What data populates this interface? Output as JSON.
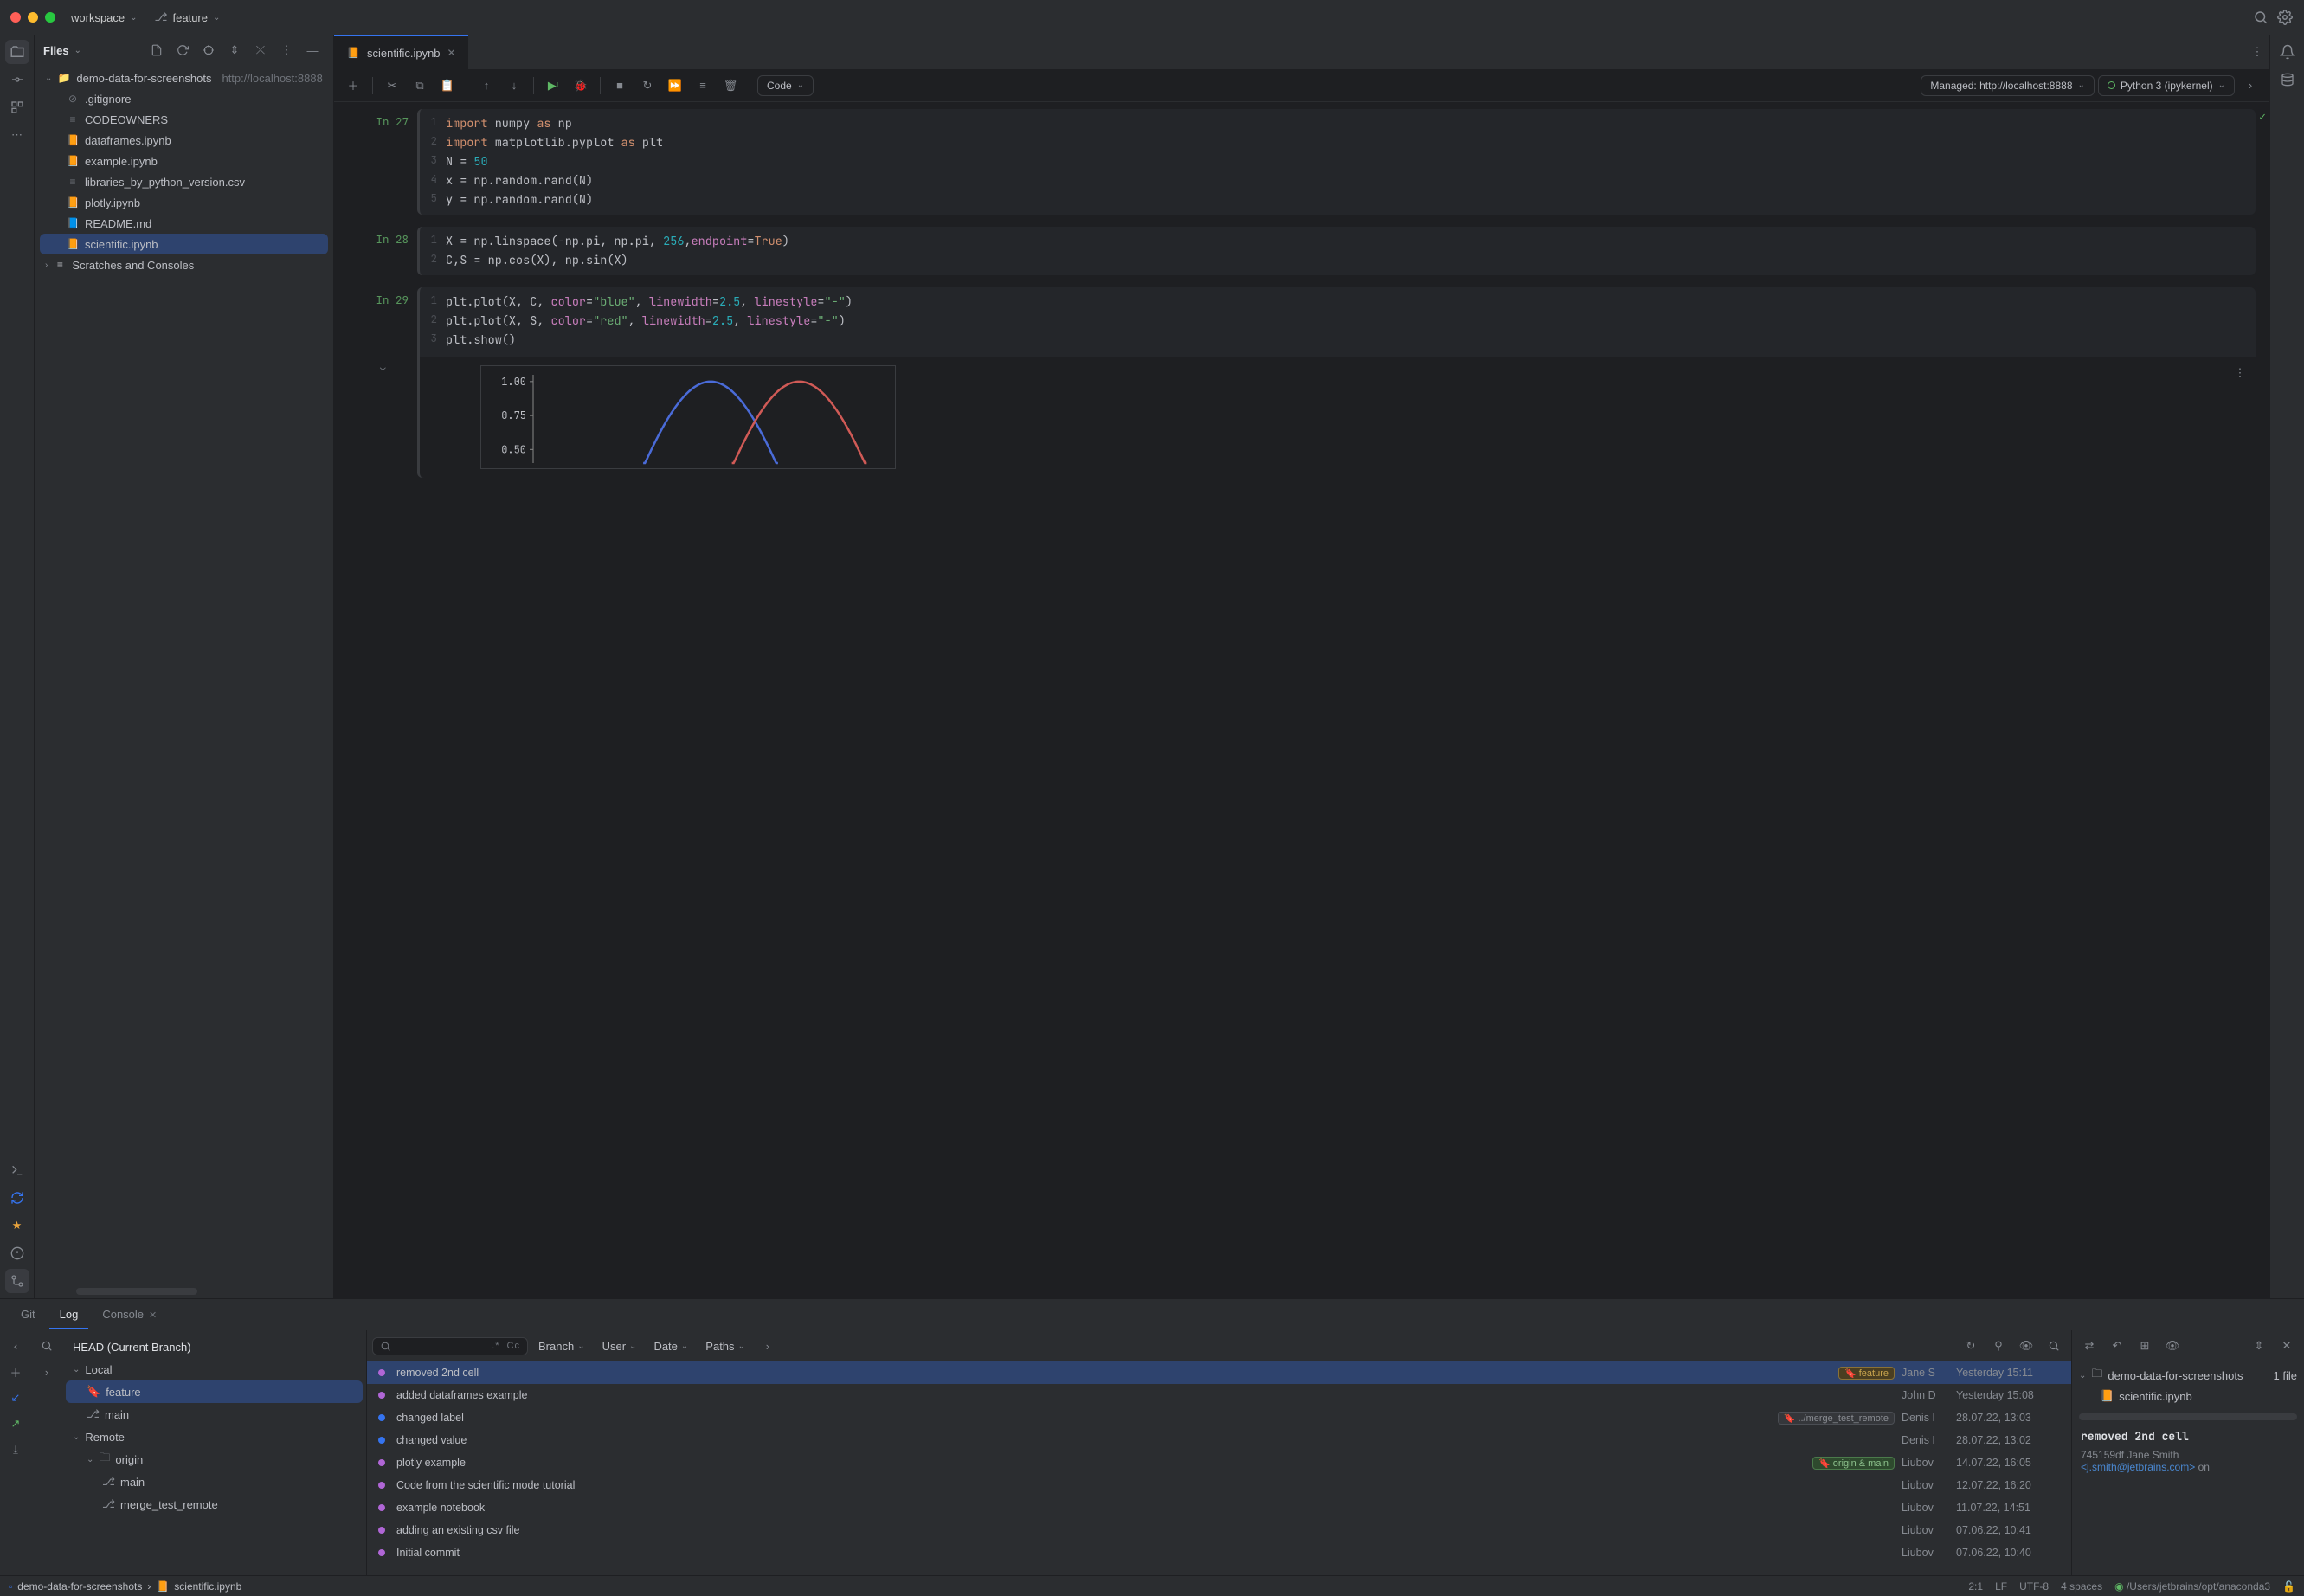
{
  "title": {
    "workspace": "workspace",
    "branch": "feature"
  },
  "project": {
    "header": "Files",
    "root": "demo-data-for-screenshots",
    "root_url": "http://localhost:8888",
    "files": [
      {
        "name": ".gitignore",
        "icon": "ignore"
      },
      {
        "name": "CODEOWNERS",
        "icon": "txt"
      },
      {
        "name": "dataframes.ipynb",
        "icon": "nb"
      },
      {
        "name": "example.ipynb",
        "icon": "nb"
      },
      {
        "name": "libraries_by_python_version.csv",
        "icon": "txt"
      },
      {
        "name": "plotly.ipynb",
        "icon": "nb"
      },
      {
        "name": "README.md",
        "icon": "md"
      },
      {
        "name": "scientific.ipynb",
        "icon": "nb",
        "selected": true
      }
    ],
    "scratches": "Scratches and Consoles"
  },
  "editor": {
    "tab": "scientific.ipynb",
    "cell_type": "Code",
    "server": "Managed: http://localhost:8888",
    "kernel": "Python 3 (ipykernel)",
    "cells": [
      {
        "prompt": "In 27",
        "lines": [
          "<span class='kw'>import</span> numpy <span class='kw'>as</span> np",
          "<span class='kw'>import</span> matplotlib.pyplot <span class='kw'>as</span> plt",
          "N = <span class='num'>50</span>",
          "x = np.random.rand(N)",
          "y = np.random.rand(N)"
        ]
      },
      {
        "prompt": "In 28",
        "lines": [
          "X = np.linspace(-np.pi<span class='par'>,</span> np.pi<span class='par'>,</span> <span class='num'>256</span><span class='par'>,</span><span class='name'>endpoint</span>=<span class='kw'>True</span>)",
          "C<span class='par'>,</span>S = np.cos(X)<span class='par'>,</span> np.sin(X)"
        ]
      },
      {
        "prompt": "In 29",
        "lines": [
          "plt.plot(X<span class='par'>,</span> C<span class='par'>,</span> <span class='name'>color</span>=<span class='str'>\"blue\"</span><span class='par'>,</span> <span class='name'>linewidth</span>=<span class='num'>2.5</span><span class='par'>,</span> <span class='name'>linestyle</span>=<span class='str'>\"-\"</span>)",
          "plt.plot(X<span class='par'>,</span> S<span class='par'>,</span> <span class='name'>color</span>=<span class='str'>\"red\"</span><span class='par'>,</span> <span class='name'>linewidth</span>=<span class='num'>2.5</span><span class='par'>,</span> <span class='name'>linestyle</span>=<span class='str'>\"-\"</span>)",
          "plt.show()"
        ],
        "output": true
      }
    ]
  },
  "bottom": {
    "tabs": [
      "Git",
      "Log",
      "Console"
    ],
    "active": "Log",
    "branches": {
      "head": "HEAD (Current Branch)",
      "local": "Local",
      "local_items": [
        "feature",
        "main"
      ],
      "remote": "Remote",
      "origin": "origin",
      "origin_items": [
        "main",
        "merge_test_remote"
      ]
    },
    "filters": {
      "branch": "Branch",
      "user": "User",
      "date": "Date",
      "paths": "Paths"
    },
    "regex": ".*",
    "cc": "Cc",
    "commits": [
      {
        "msg": "removed 2nd cell",
        "tags": [
          {
            "t": "feature",
            "c": "yellow"
          }
        ],
        "author": "Jane S",
        "date": "Yesterday 15:11",
        "sel": true,
        "g": 1
      },
      {
        "msg": "added dataframes example",
        "author": "John D",
        "date": "Yesterday 15:08",
        "g": 1
      },
      {
        "msg": "changed label",
        "tags": [
          {
            "t": "../merge_test_remote",
            "c": "gray"
          }
        ],
        "author": "Denis I",
        "date": "28.07.22, 13:03",
        "g": 2
      },
      {
        "msg": "changed value",
        "author": "Denis I",
        "date": "28.07.22, 13:02",
        "g": 2
      },
      {
        "msg": "plotly example",
        "tags": [
          {
            "t": "origin & main",
            "c": "green"
          }
        ],
        "author": "Liubov",
        "date": "14.07.22, 16:05",
        "g": 1
      },
      {
        "msg": "Code from the scientific mode tutorial",
        "author": "Liubov",
        "date": "12.07.22, 16:20",
        "g": 1
      },
      {
        "msg": "example notebook",
        "author": "Liubov",
        "date": "11.07.22, 14:51",
        "g": 1
      },
      {
        "msg": "adding an existing csv file",
        "author": "Liubov",
        "date": "07.06.22, 10:41",
        "g": 1
      },
      {
        "msg": "Initial commit",
        "author": "Liubov",
        "date": "07.06.22, 10:40",
        "g": 1
      }
    ],
    "details": {
      "root": "demo-data-for-screenshots",
      "root_count": "1 file",
      "file": "scientific.ipynb",
      "title": "removed 2nd cell",
      "hash_author": "745159df Jane Smith",
      "email": "<j.smith@jetbrains.com>",
      "on": "on"
    }
  },
  "status": {
    "crumb_root": "demo-data-for-screenshots",
    "crumb_file": "scientific.ipynb",
    "pos": "2:1",
    "lf": "LF",
    "enc": "UTF-8",
    "indent": "4 spaces",
    "interp": "/Users/jetbrains/opt/anaconda3"
  },
  "chart_data": {
    "type": "line",
    "title": "",
    "xlabel": "",
    "ylabel": "",
    "x_range": [
      -3.1416,
      3.1416
    ],
    "y_ticks": [
      0.5,
      0.75,
      1.0
    ],
    "ylim": [
      0.4,
      1.05
    ],
    "series": [
      {
        "name": "cos(x)",
        "color": "#4a6bd8"
      },
      {
        "name": "sin(x)",
        "color": "#d05a56"
      }
    ]
  }
}
